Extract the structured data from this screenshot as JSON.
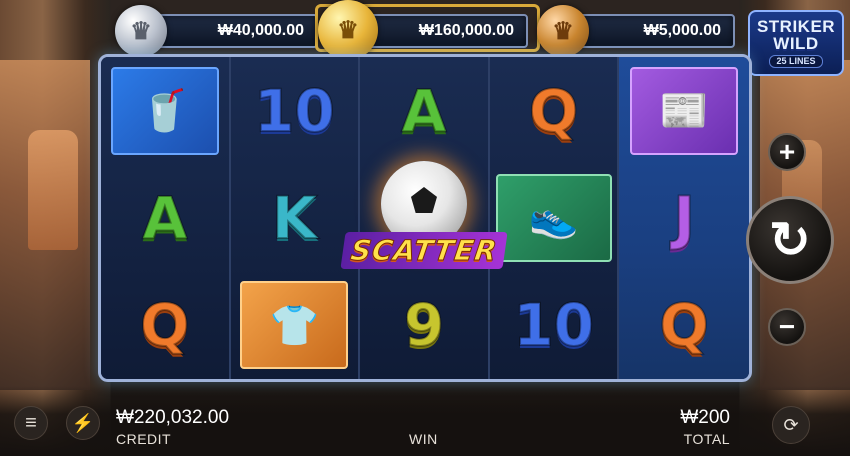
{
  "jackpots": {
    "silver": "₩40,000.00",
    "gold": "₩160,000.00",
    "bronze": "₩5,000.00"
  },
  "logo": {
    "line1": "STRIKER",
    "line2": "WILD",
    "lines_badge": "25 LINES"
  },
  "reels": [
    {
      "symbols": [
        "drinks-icon",
        "A",
        "Q"
      ]
    },
    {
      "symbols": [
        "10",
        "K",
        "jersey-icon"
      ]
    },
    {
      "symbols": [
        "A",
        "SCATTER",
        "9"
      ]
    },
    {
      "symbols": [
        "Q",
        "boot-icon",
        "10"
      ]
    },
    {
      "symbols": [
        "news-icon",
        "J",
        "Q"
      ]
    }
  ],
  "reel_text": {
    "r1c2": "A",
    "r1c3": "Q",
    "r2c1": "10",
    "r2c2": "K",
    "r3c1": "A",
    "r3c3": "9",
    "r4c1": "Q",
    "r4c3": "10",
    "r5c2": "J",
    "r5c3": "Q"
  },
  "scatter_label": "SCATTER",
  "bottom": {
    "credit_value": "₩220,032.00",
    "credit_label": "CREDIT",
    "win_label": "WIN",
    "total_value": "₩200",
    "total_label": "TOTAL"
  },
  "controls": {
    "plus": "+",
    "minus": "−",
    "spin": "↻",
    "menu": "≡",
    "bolt": "⚡",
    "auto": "⟳"
  },
  "colors": {
    "frame": "#9fb2d9",
    "reel_bg": "#1a2c52",
    "highlight_reel": "#1f4c9a"
  }
}
